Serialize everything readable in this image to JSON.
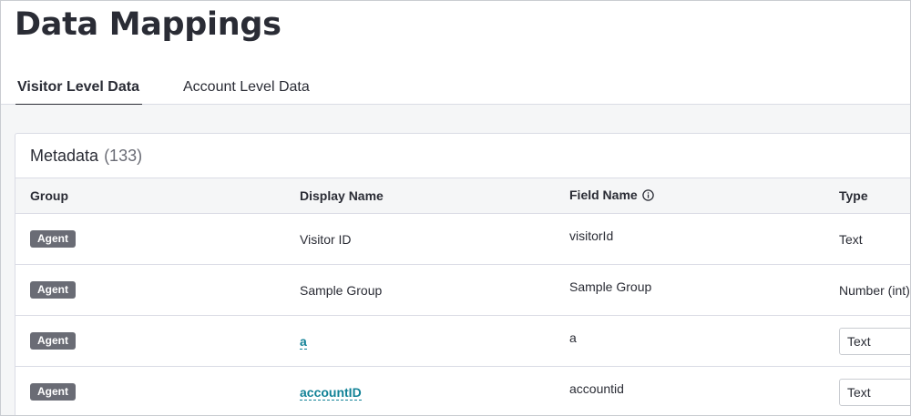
{
  "page": {
    "title": "Data Mappings"
  },
  "tabs": [
    {
      "label": "Visitor Level Data",
      "active": true
    },
    {
      "label": "Account Level Data",
      "active": false
    }
  ],
  "metadata": {
    "title": "Metadata",
    "count": "(133)",
    "columns": {
      "group": "Group",
      "display_name": "Display Name",
      "field_name": "Field Name",
      "type": "Type"
    },
    "rows": [
      {
        "group": "Agent",
        "display_name": "Visitor ID",
        "display_is_link": false,
        "field_name": "visitorId",
        "type": "Text",
        "type_is_select": false
      },
      {
        "group": "Agent",
        "display_name": "Sample Group",
        "display_is_link": false,
        "field_name": "Sample Group",
        "type": "Number (int)",
        "type_is_select": false
      },
      {
        "group": "Agent",
        "display_name": "a",
        "display_is_link": true,
        "field_name": "a",
        "type": "Text",
        "type_is_select": true
      },
      {
        "group": "Agent",
        "display_name": "accountID",
        "display_is_link": true,
        "field_name": "accountid",
        "type": "Text",
        "type_is_select": true
      }
    ]
  },
  "icons": {
    "info": "info-icon",
    "select_chevron": "chevron-down-icon"
  },
  "colors": {
    "badge_bg": "#6a6c75",
    "link": "#128297",
    "header_bg": "#f5f6f7",
    "border": "#dadce5"
  }
}
